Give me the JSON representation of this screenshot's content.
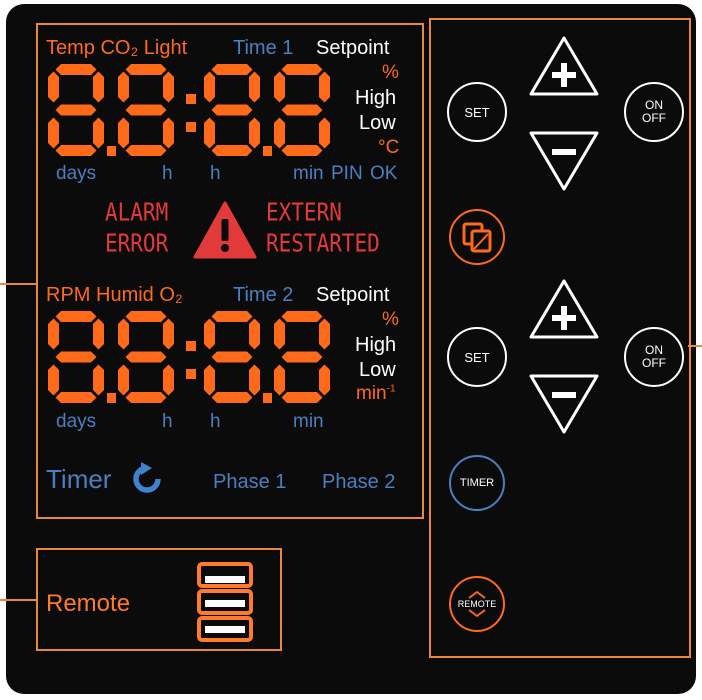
{
  "display1": {
    "modes": [
      "Temp",
      "CO₂",
      "Light"
    ],
    "time": "Time 1",
    "setpoint": "Setpoint",
    "units": {
      "percent": "%",
      "high": "High",
      "low": "Low",
      "celsius": "°C"
    },
    "scale": {
      "days": "days",
      "h1": "h",
      "h2": "h",
      "min": "min",
      "pin": "PIN",
      "ok": "OK"
    }
  },
  "alarm": {
    "left_top": "ALARM",
    "left_bottom": "ERROR",
    "right_top": "EXTERN",
    "right_bottom": "RESTARTED"
  },
  "display2": {
    "modes": [
      "RPM",
      "Humid",
      "O₂"
    ],
    "time": "Time 2",
    "setpoint": "Setpoint",
    "units": {
      "percent": "%",
      "high": "High",
      "low": "Low",
      "rpm_unit": "min",
      "rpm_exp": "-1"
    },
    "scale": {
      "days": "days",
      "h1": "h",
      "h2": "h",
      "min": "min"
    }
  },
  "timer": {
    "label": "Timer",
    "phase1": "Phase 1",
    "phase2": "Phase 2"
  },
  "remote": {
    "label": "Remote"
  },
  "controls": {
    "set1": "SET",
    "onoff1_top": "ON",
    "onoff1_bottom": "OFF",
    "set2": "SET",
    "onoff2_top": "ON",
    "onoff2_bottom": "OFF",
    "timer": "TIMER",
    "remote": "REMOTE"
  },
  "colors": {
    "accent": "#ff6a1a",
    "border": "#e98a3a",
    "blue": "#4b7fc0",
    "alarm": "#e23a3a"
  },
  "icons": [
    "plus-triangle-icon",
    "minus-triangle-icon",
    "warning-icon",
    "copy-icon",
    "refresh-icon",
    "stacked-layers-icon"
  ]
}
